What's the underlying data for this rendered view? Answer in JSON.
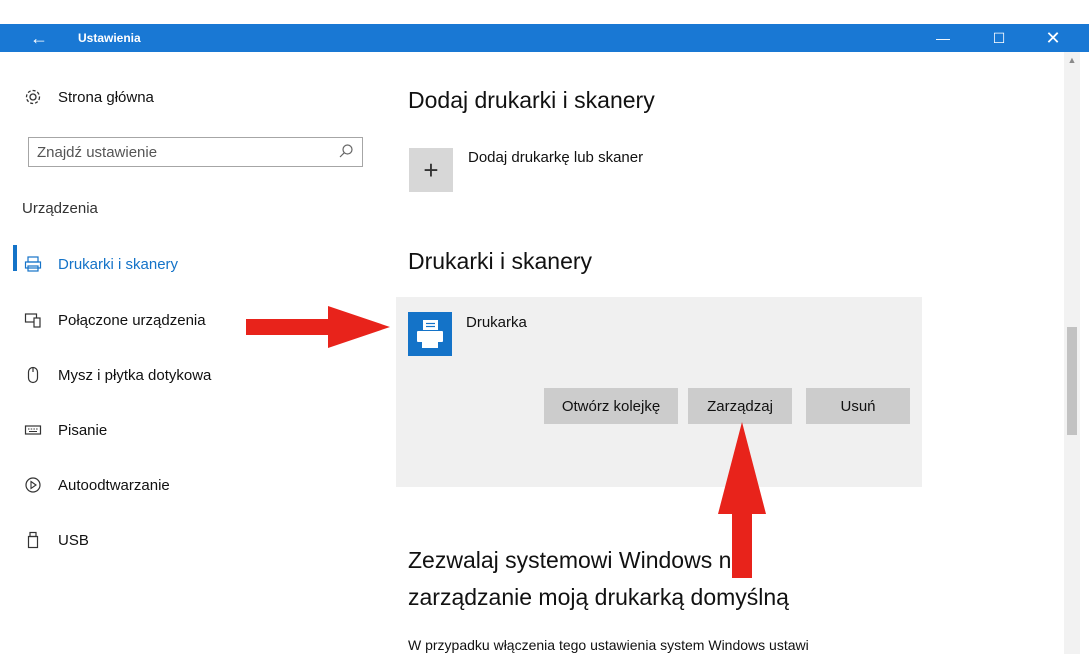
{
  "window": {
    "title": "Ustawienia",
    "back_glyph": "←",
    "minimize_glyph": "—",
    "maximize_glyph": "☐",
    "close_glyph": "✕",
    "accent_color": "#1978d4"
  },
  "sidebar": {
    "home_label": "Strona główna",
    "search_placeholder": "Znajdź ustawienie",
    "section_label": "Urządzenia",
    "items": [
      {
        "label": "Drukarki i skanery",
        "icon": "printer-icon",
        "active": true
      },
      {
        "label": "Połączone urządzenia",
        "icon": "connected-devices-icon",
        "active": false
      },
      {
        "label": "Mysz i płytka dotykowa",
        "icon": "mouse-icon",
        "active": false
      },
      {
        "label": "Pisanie",
        "icon": "keyboard-icon",
        "active": false
      },
      {
        "label": "Autoodtwarzanie",
        "icon": "autoplay-icon",
        "active": false
      },
      {
        "label": "USB",
        "icon": "usb-icon",
        "active": false
      }
    ]
  },
  "main": {
    "add_heading": "Dodaj drukarki i skanery",
    "add_label": "Dodaj drukarkę lub skaner",
    "add_glyph": "+",
    "list_heading": "Drukarki i skanery",
    "printer": {
      "name": "Drukarka",
      "open_queue_label": "Otwórz kolejkę",
      "manage_label": "Zarządzaj",
      "remove_label": "Usuń"
    },
    "default_heading_line1": "Zezwalaj systemowi Windows na",
    "default_heading_line2": "zarządzanie moją drukarką domyślną",
    "default_description": "W przypadku włączenia tego ustawienia system Windows ustawi"
  },
  "annotations": {
    "arrow_color": "#e8231b"
  }
}
